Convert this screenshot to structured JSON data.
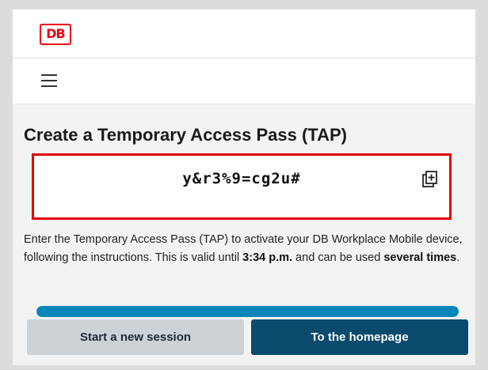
{
  "header": {
    "logo_text": "DB"
  },
  "menu": {
    "icon": "hamburger-menu-icon"
  },
  "main": {
    "title": "Create a Temporary Access Pass (TAP)",
    "tap_code": "y&r3%9=cg2u#",
    "copy_icon": "copy-icon",
    "description": {
      "part1": "Enter the Temporary Access Pass (TAP) to activate your DB Workplace Mobile device, following the instructions. This is valid until ",
      "valid_until": "3:34 p.m.",
      "part2": " and can be used ",
      "usage": "several times",
      "part3": "."
    },
    "progress_percent": 100,
    "buttons": {
      "new_session": "Start a new session",
      "homepage": "To the homepage"
    }
  },
  "colors": {
    "brand_red": "#ec0016",
    "highlight_border": "#e00000",
    "progress": "#0a86b8",
    "primary_button": "#0a4a6d",
    "secondary_button": "#cdd2d6"
  }
}
